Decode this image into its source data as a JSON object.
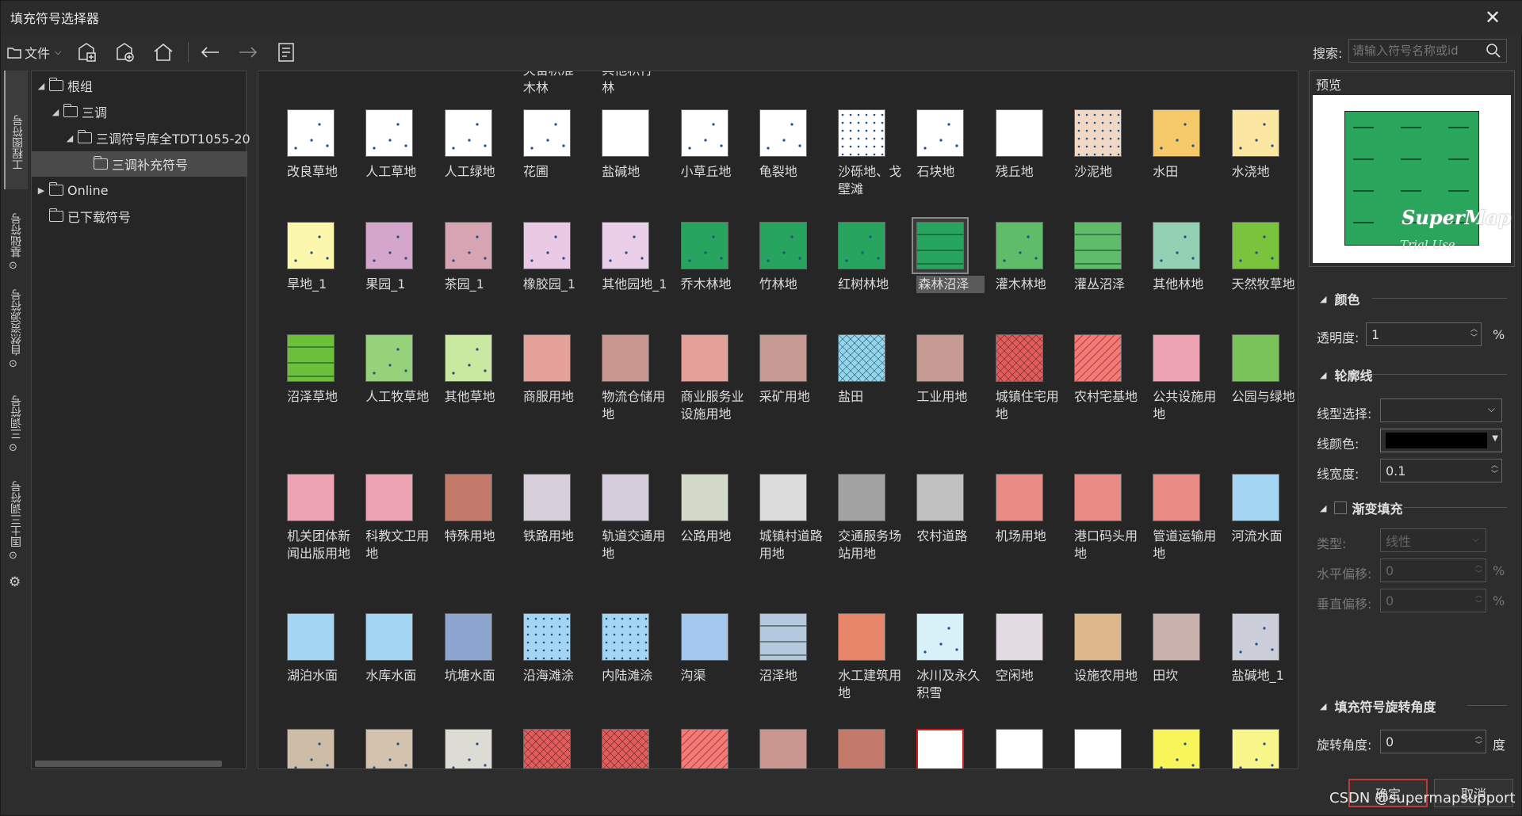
{
  "window": {
    "title": "填充符号选择器"
  },
  "toolbar": {
    "file_label": "文件"
  },
  "search": {
    "label": "搜索:",
    "placeholder": "请输入符号名称或id"
  },
  "vtabs": [
    "工程图符号",
    "基础符号",
    "自然资源符号",
    "三调符号",
    "国土三调符号"
  ],
  "tree": {
    "root": "根组",
    "sandiao": "三调",
    "library": "三调符号库全TDT1055-20",
    "supplement": "三调补充符号",
    "online": "Online",
    "downloaded": "已下载符号"
  },
  "top_partial_labels": [
    [
      "",
      ""
    ],
    [
      "",
      ""
    ],
    [
      "",
      ""
    ],
    [
      "灭宙积准",
      "木林"
    ],
    [
      "兵他积行",
      "林"
    ],
    [
      "",
      ""
    ],
    [
      "",
      ""
    ],
    [
      "",
      ""
    ],
    [
      "",
      ""
    ],
    [
      "",
      ""
    ],
    [
      "",
      ""
    ],
    [
      "",
      ""
    ],
    [
      "",
      ""
    ]
  ],
  "grid_rows": [
    [
      {
        "label": "改良草地",
        "color": "#ffffff",
        "pattern": "dots"
      },
      {
        "label": "人工草地",
        "color": "#ffffff",
        "pattern": "dots"
      },
      {
        "label": "人工绿地",
        "color": "#ffffff",
        "pattern": "dots"
      },
      {
        "label": "花圃",
        "color": "#ffffff",
        "pattern": "dots"
      },
      {
        "label": "盐碱地",
        "color": "#ffffff",
        "pattern": "none"
      },
      {
        "label": "小草丘地",
        "color": "#ffffff",
        "pattern": "dots"
      },
      {
        "label": "龟裂地",
        "color": "#ffffff",
        "pattern": "dots"
      },
      {
        "label": "沙砾地、戈壁滩",
        "color": "#ffffff",
        "pattern": "dense"
      },
      {
        "label": "石块地",
        "color": "#ffffff",
        "pattern": "dots"
      },
      {
        "label": "残丘地",
        "color": "#ffffff",
        "pattern": "none"
      },
      {
        "label": "沙泥地",
        "color": "#f0d8c4",
        "pattern": "dense"
      },
      {
        "label": "水田",
        "color": "#f5c96a",
        "pattern": "dots"
      },
      {
        "label": "水浇地",
        "color": "#fbe7a1",
        "pattern": "dots"
      }
    ],
    [
      {
        "label": "旱地_1",
        "color": "#fbf8ae",
        "pattern": "dots"
      },
      {
        "label": "果园_1",
        "color": "#d5a6cc",
        "pattern": "dots"
      },
      {
        "label": "茶园_1",
        "color": "#d7a5b2",
        "pattern": "dots"
      },
      {
        "label": "橡胶园_1",
        "color": "#e9c9e4",
        "pattern": "dots"
      },
      {
        "label": "其他园地_1",
        "color": "#ebcfe8",
        "pattern": "dots"
      },
      {
        "label": "乔木林地",
        "color": "#27a55f",
        "pattern": "dots"
      },
      {
        "label": "竹林地",
        "color": "#27a55f",
        "pattern": "dots"
      },
      {
        "label": "红树林地",
        "color": "#27a55f",
        "pattern": "dots"
      },
      {
        "label": "森林沼泽",
        "color": "#27a55f",
        "pattern": "lines"
      },
      {
        "label": "灌木林地",
        "color": "#5fbd6a",
        "pattern": "dots"
      },
      {
        "label": "灌丛沼泽",
        "color": "#5fbd6a",
        "pattern": "lines"
      },
      {
        "label": "其他林地",
        "color": "#93d1b3",
        "pattern": "dots"
      },
      {
        "label": "天然牧草地",
        "color": "#7ac33c",
        "pattern": "dots"
      }
    ],
    [
      {
        "label": "沼泽草地",
        "color": "#6cc13a",
        "pattern": "lines"
      },
      {
        "label": "人工牧草地",
        "color": "#96d27a",
        "pattern": "dots"
      },
      {
        "label": "其他草地",
        "color": "#c9e8a0",
        "pattern": "dots"
      },
      {
        "label": "商服用地",
        "color": "#e3a19a",
        "pattern": "none"
      },
      {
        "label": "物流仓储用地",
        "color": "#c9978f",
        "pattern": "none"
      },
      {
        "label": "商业服务业设施用地",
        "color": "#e3a19a",
        "pattern": "none"
      },
      {
        "label": "采矿用地",
        "color": "#c59a93",
        "pattern": "none"
      },
      {
        "label": "盐田",
        "color": "#8fd6ee",
        "pattern": "cross"
      },
      {
        "label": "工业用地",
        "color": "#c59a93",
        "pattern": "none"
      },
      {
        "label": "城镇住宅用地",
        "color": "#e35b5b",
        "pattern": "cross"
      },
      {
        "label": "农村宅基地",
        "color": "#ef7b7b",
        "pattern": "hatch"
      },
      {
        "label": "公共设施用地",
        "color": "#eea3b3",
        "pattern": "none"
      },
      {
        "label": "公园与绿地",
        "color": "#79c35a",
        "pattern": "none"
      }
    ],
    [
      {
        "label": "机关团体新闻出版用地",
        "color": "#eea3b3",
        "pattern": "none"
      },
      {
        "label": "科教文卫用地",
        "color": "#eea3b3",
        "pattern": "none"
      },
      {
        "label": "特殊用地",
        "color": "#c47a6a",
        "pattern": "none"
      },
      {
        "label": "铁路用地",
        "color": "#d6cfd9",
        "pattern": "none"
      },
      {
        "label": "轨道交通用地",
        "color": "#d5cddc",
        "pattern": "none"
      },
      {
        "label": "公路用地",
        "color": "#d4dac8",
        "pattern": "none"
      },
      {
        "label": "城镇村道路用地",
        "color": "#dcdcdc",
        "pattern": "none"
      },
      {
        "label": "交通服务场站用地",
        "color": "#a3a3a3",
        "pattern": "none"
      },
      {
        "label": "农村道路",
        "color": "#c0c0c0",
        "pattern": "none"
      },
      {
        "label": "机场用地",
        "color": "#ea8a84",
        "pattern": "none"
      },
      {
        "label": "港口码头用地",
        "color": "#ea8a84",
        "pattern": "none"
      },
      {
        "label": "管道运输用地",
        "color": "#ea8a84",
        "pattern": "none"
      },
      {
        "label": "河流水面",
        "color": "#a4d6f3",
        "pattern": "none"
      }
    ],
    [
      {
        "label": "湖泊水面",
        "color": "#a4d6f3",
        "pattern": "none"
      },
      {
        "label": "水库水面",
        "color": "#a4d6f3",
        "pattern": "none"
      },
      {
        "label": "坑塘水面",
        "color": "#8ea6cf",
        "pattern": "none"
      },
      {
        "label": "沿海滩涂",
        "color": "#a4d6f3",
        "pattern": "dense"
      },
      {
        "label": "内陆滩涂",
        "color": "#a4d6f3",
        "pattern": "dense"
      },
      {
        "label": "沟渠",
        "color": "#a4c8ee",
        "pattern": "none"
      },
      {
        "label": "沼泽地",
        "color": "#b5c8de",
        "pattern": "lines"
      },
      {
        "label": "水工建筑用地",
        "color": "#e8866a",
        "pattern": "none"
      },
      {
        "label": "冰川及永久积雪",
        "color": "#d8f1f8",
        "pattern": "dots"
      },
      {
        "label": "空闲地",
        "color": "#e2dbe2",
        "pattern": "none"
      },
      {
        "label": "设施农用地",
        "color": "#dcb88a",
        "pattern": "none"
      },
      {
        "label": "田坎",
        "color": "#c9b1ad",
        "pattern": "none"
      },
      {
        "label": "盐碱地_1",
        "color": "#cccfd9",
        "pattern": "dots"
      }
    ],
    [
      {
        "label": "",
        "color": "#cdbda6",
        "pattern": "dots"
      },
      {
        "label": "",
        "color": "#d3c3ae",
        "pattern": "dots"
      },
      {
        "label": "",
        "color": "#dcdcd4",
        "pattern": "dots"
      },
      {
        "label": "",
        "color": "#e35b5b",
        "pattern": "cross"
      },
      {
        "label": "",
        "color": "#e35b5b",
        "pattern": "cross"
      },
      {
        "label": "",
        "color": "#ef7b7b",
        "pattern": "hatch"
      },
      {
        "label": "",
        "color": "#c9978f",
        "pattern": "none"
      },
      {
        "label": "",
        "color": "#c47a6a",
        "pattern": "none"
      },
      {
        "label": "",
        "color": "#ffffff",
        "pattern": "red-border"
      },
      {
        "label": "",
        "color": "#ffffff",
        "pattern": "none"
      },
      {
        "label": "",
        "color": "#ffffff",
        "pattern": "none"
      },
      {
        "label": "",
        "color": "#f7f55a",
        "pattern": "dots"
      },
      {
        "label": "",
        "color": "#f8f68a",
        "pattern": "dots"
      }
    ]
  ],
  "selected_symbol": "森林沼泽",
  "preview": {
    "title": "预览",
    "watermark": "SuperMap",
    "watermark_sub": "Trial Use",
    "fill_color": "#2aa65c"
  },
  "props": {
    "color_section": "颜色",
    "transparency_label": "透明度:",
    "transparency_value": "1",
    "transparency_unit": "%",
    "outline_section": "轮廓线",
    "line_type_label": "线型选择:",
    "line_color_label": "线颜色:",
    "line_color": "#000000",
    "line_width_label": "线宽度:",
    "line_width_value": "0.1",
    "gradient_section": "渐变填充",
    "type_label": "类型:",
    "type_value": "线性",
    "h_offset_label": "水平偏移:",
    "h_offset_value": "0",
    "v_offset_label": "垂直偏移:",
    "v_offset_value": "0",
    "offset_unit": "%",
    "rotation_section": "填充符号旋转角度",
    "rotation_label": "旋转角度:",
    "rotation_value": "0",
    "rotation_unit": "度"
  },
  "buttons": {
    "ok": "确定",
    "cancel": "取消"
  },
  "watermark": "CSDN @supermapsupport"
}
